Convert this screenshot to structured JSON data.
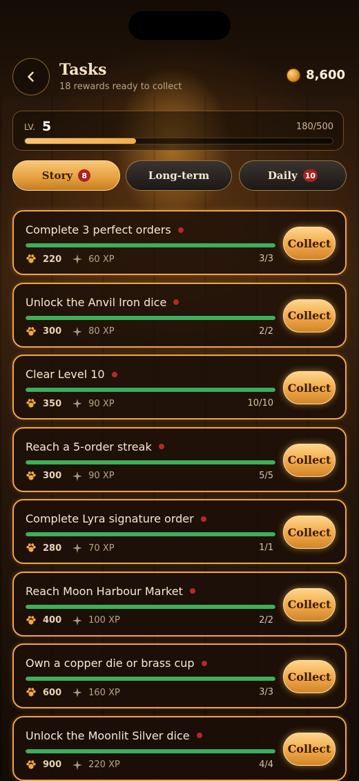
{
  "header": {
    "title": "Tasks",
    "subtitle": "18 rewards ready to collect",
    "back_icon": "chevron-left-icon",
    "coins": "8,600"
  },
  "level": {
    "label": "LV.",
    "value": "5",
    "xp_text": "180/500",
    "progress_fraction": 0.36
  },
  "tabs": [
    {
      "label": "Story",
      "badge": "8",
      "active": true
    },
    {
      "label": "Long-term",
      "badge": "",
      "active": false
    },
    {
      "label": "Daily",
      "badge": "10",
      "active": false
    }
  ],
  "colors": {
    "accent": "#efa54c",
    "progress_green": "#3fae5a",
    "badge_red": "#a8231f"
  },
  "tasks": [
    {
      "title": "Complete 3 perfect orders",
      "coins": "220",
      "xp": "60 XP",
      "progress": "3/3",
      "fraction": 1,
      "button": "Collect"
    },
    {
      "title": "Unlock the Anvil Iron dice",
      "coins": "300",
      "xp": "80 XP",
      "progress": "2/2",
      "fraction": 1,
      "button": "Collect"
    },
    {
      "title": "Clear Level 10",
      "coins": "350",
      "xp": "90 XP",
      "progress": "10/10",
      "fraction": 1,
      "button": "Collect"
    },
    {
      "title": "Reach a 5-order streak",
      "coins": "300",
      "xp": "90 XP",
      "progress": "5/5",
      "fraction": 1,
      "button": "Collect"
    },
    {
      "title": "Complete Lyra signature order",
      "coins": "280",
      "xp": "70 XP",
      "progress": "1/1",
      "fraction": 1,
      "button": "Collect"
    },
    {
      "title": "Reach Moon Harbour Market",
      "coins": "400",
      "xp": "100 XP",
      "progress": "2/2",
      "fraction": 1,
      "button": "Collect"
    },
    {
      "title": "Own a copper die or brass cup",
      "coins": "600",
      "xp": "160 XP",
      "progress": "3/3",
      "fraction": 1,
      "button": "Collect"
    },
    {
      "title": "Unlock the Moonlit Silver dice",
      "coins": "900",
      "xp": "220 XP",
      "progress": "4/4",
      "fraction": 1,
      "button": "Collect"
    }
  ]
}
